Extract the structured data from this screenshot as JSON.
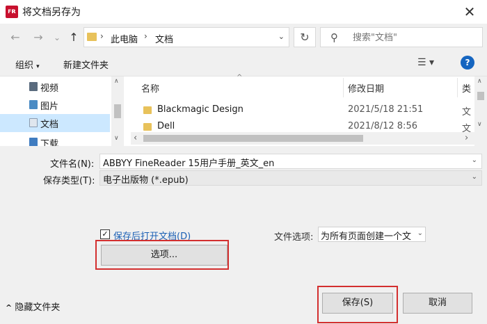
{
  "window": {
    "title": "将文档另存为",
    "close_glyph": "✕"
  },
  "nav": {
    "back_glyph": "←",
    "forward_glyph": "→",
    "history_glyph": "⌄",
    "up_glyph": "↑"
  },
  "address": {
    "separator": "›",
    "crumbs": [
      "此电脑",
      "文档"
    ],
    "dropdown_glyph": "⌄",
    "refresh_glyph": "↻"
  },
  "search": {
    "icon": "search-icon",
    "placeholder": "搜索\"文档\""
  },
  "toolbar": {
    "organize_label": "组织",
    "organize_caret": "▾",
    "new_folder_label": "新建文件夹",
    "view_glyph": "☰ ▾",
    "help_glyph": "?"
  },
  "sidebar": {
    "items": [
      {
        "label": "视频",
        "icon": "video-folder-icon",
        "selected": false
      },
      {
        "label": "图片",
        "icon": "pictures-folder-icon",
        "selected": false
      },
      {
        "label": "文档",
        "icon": "documents-folder-icon",
        "selected": true
      },
      {
        "label": "下载",
        "icon": "downloads-folder-icon",
        "selected": false
      }
    ],
    "scroll_up": "∧",
    "scroll_down": "∨"
  },
  "files": {
    "columns": [
      "名称",
      "修改日期",
      "类"
    ],
    "sort_glyph": "^",
    "rows": [
      {
        "name": "Blackmagic Design",
        "date": "2021/5/18 21:51",
        "type": "文"
      },
      {
        "name": "Dell",
        "date": "2021/8/12 8:56",
        "type": "文"
      }
    ],
    "scroll_up": "∧",
    "scroll_down": "∨",
    "scroll_left": "‹",
    "scroll_right": "›"
  },
  "form": {
    "filename_label": "文件名(N):",
    "filename_value": "ABBYY FineReader 15用户手册_英文_en",
    "filetype_label": "保存类型(T):",
    "filetype_value": "电子出版物 (*.epub)",
    "dropdown_glyph": "⌄",
    "open_after_save_checked": true,
    "check_glyph": "✓",
    "open_after_save_label": "保存后打开文档(D)",
    "options_button": "选项...",
    "file_options_label": "文件选项:",
    "file_options_value": "为所有页面创建一个文"
  },
  "footer": {
    "hide_folders_label": "隐藏文件夹",
    "hide_folders_caret": "^",
    "save_button": "保存(S)",
    "cancel_button": "取消"
  },
  "colors": {
    "highlight": "#d32f2f",
    "link": "#1a5fb4",
    "help": "#1565c0",
    "selected_row": "#cce8ff",
    "folder": "#e8c25b"
  }
}
